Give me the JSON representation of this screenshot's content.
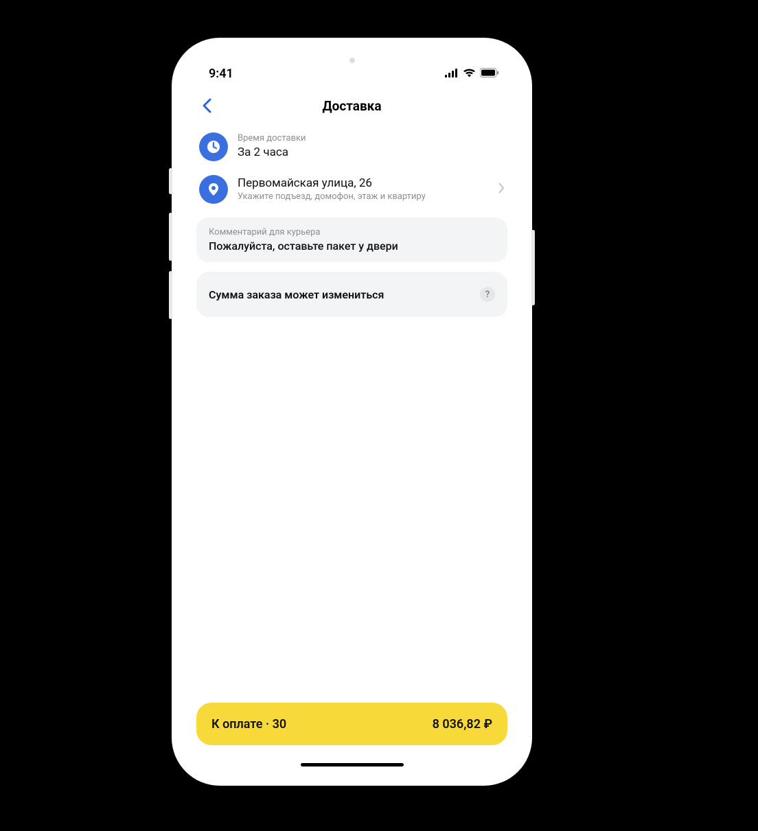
{
  "status": {
    "time": "9:41"
  },
  "nav": {
    "title": "Доставка"
  },
  "delivery_time": {
    "label": "Время доставки",
    "value": "За 2 часа"
  },
  "address": {
    "value": "Первомайская улица, 26",
    "sub": "Укажите подъезд, домофон, этаж и квартиру"
  },
  "comment": {
    "label": "Комментарий для курьера",
    "value": "Пожалуйста, оставьте пакет у двери"
  },
  "notice": {
    "text": "Сумма заказа может измениться",
    "help": "?"
  },
  "payment": {
    "left": "К оплате · 30",
    "right": "8 036,82 ₽"
  }
}
